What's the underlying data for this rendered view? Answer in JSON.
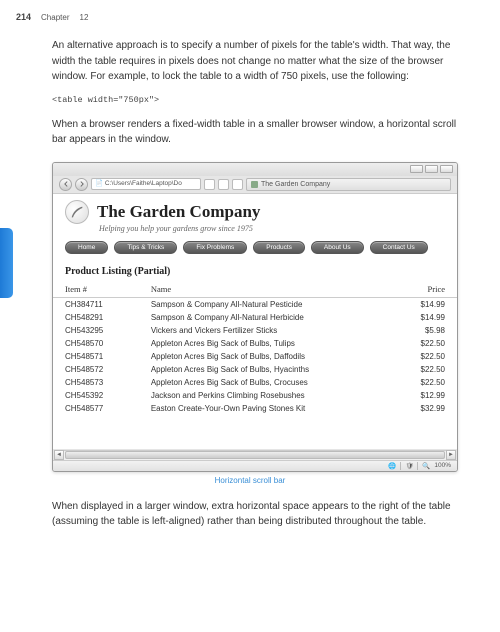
{
  "header": {
    "page_number": "214",
    "chapter_label": "Chapter",
    "chapter_num": "12"
  },
  "paragraphs": {
    "p1": "An alternative approach is to specify a number of pixels for the table's width. That way, the width the table requires in pixels does not change no matter what the size of the browser window. For example, to lock the table to a width of 750 pixels, use the following:",
    "code1": "<table width=\"750px\">",
    "p2": "When a browser renders a fixed-width table in a smaller browser window, a horizontal scroll bar appears in the window.",
    "caption": "Horizontal scroll bar",
    "p3": "When displayed in a larger window, extra horizontal space appears to the right of the table (assuming the table is left-aligned) rather than being distributed throughout the table."
  },
  "browser": {
    "address": "C:\\Users\\Faithe\\Laptop\\Do",
    "tab_title": "The Garden Company",
    "company_title": "The Garden Company",
    "company_sub": "Helping you help your gardens grow since 1975",
    "nav": [
      "Home",
      "Tips & Tricks",
      "Fix Problems",
      "Products",
      "About Us",
      "Contact Us"
    ],
    "section_heading": "Product Listing (Partial)",
    "columns": {
      "c0": "Item #",
      "c1": "Name",
      "c2": "Price"
    },
    "rows": [
      {
        "id": "CH384711",
        "name": "Sampson & Company All-Natural Pesticide",
        "price": "$14.99"
      },
      {
        "id": "CH548291",
        "name": "Sampson & Company All-Natural Herbicide",
        "price": "$14.99"
      },
      {
        "id": "CH543295",
        "name": "Vickers and Vickers Fertilizer Sticks",
        "price": "$5.98"
      },
      {
        "id": "CH548570",
        "name": "Appleton Acres Big Sack of Bulbs, Tulips",
        "price": "$22.50"
      },
      {
        "id": "CH548571",
        "name": "Appleton Acres Big Sack of Bulbs, Daffodils",
        "price": "$22.50"
      },
      {
        "id": "CH548572",
        "name": "Appleton Acres Big Sack of Bulbs, Hyacinths",
        "price": "$22.50"
      },
      {
        "id": "CH548573",
        "name": "Appleton Acres Big Sack of Bulbs, Crocuses",
        "price": "$22.50"
      },
      {
        "id": "CH545392",
        "name": "Jackson and Perkins Climbing Rosebushes",
        "price": "$12.99"
      },
      {
        "id": "CH548577",
        "name": "Easton Create-Your-Own Paving Stones Kit",
        "price": "$32.99"
      }
    ],
    "status": {
      "zoom": "100%"
    }
  }
}
